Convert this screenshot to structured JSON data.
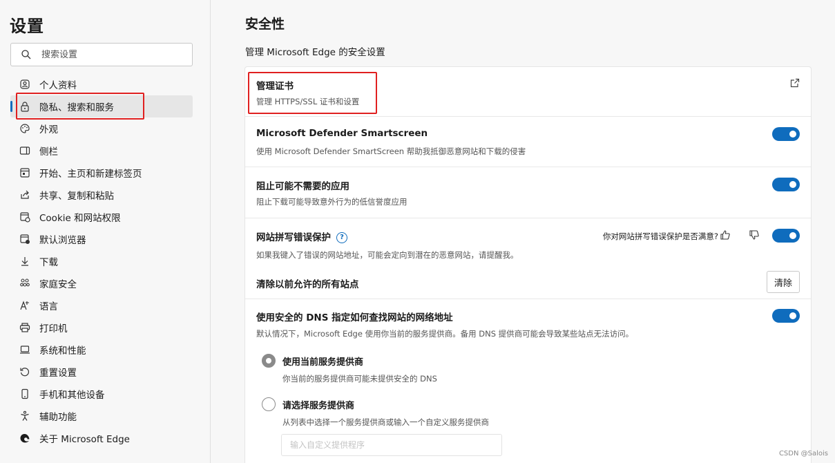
{
  "sidebar": {
    "title": "设置",
    "search_placeholder": "搜索设置",
    "items": [
      {
        "label": "个人资料",
        "icon": "profile-icon"
      },
      {
        "label": "隐私、搜索和服务",
        "icon": "lock-icon",
        "active": true
      },
      {
        "label": "外观",
        "icon": "palette-icon"
      },
      {
        "label": "侧栏",
        "icon": "sidebar-icon"
      },
      {
        "label": "开始、主页和新建标签页",
        "icon": "home-icon"
      },
      {
        "label": "共享、复制和粘贴",
        "icon": "share-icon"
      },
      {
        "label": "Cookie 和网站权限",
        "icon": "cookie-icon"
      },
      {
        "label": "默认浏览器",
        "icon": "browser-icon"
      },
      {
        "label": "下载",
        "icon": "download-icon"
      },
      {
        "label": "家庭安全",
        "icon": "family-icon"
      },
      {
        "label": "语言",
        "icon": "language-icon"
      },
      {
        "label": "打印机",
        "icon": "printer-icon"
      },
      {
        "label": "系统和性能",
        "icon": "laptop-icon"
      },
      {
        "label": "重置设置",
        "icon": "reset-icon"
      },
      {
        "label": "手机和其他设备",
        "icon": "phone-icon"
      },
      {
        "label": "辅助功能",
        "icon": "accessibility-icon"
      },
      {
        "label": "关于 Microsoft Edge",
        "icon": "edge-logo-icon"
      }
    ]
  },
  "main": {
    "title": "安全性",
    "subtitle": "管理 Microsoft Edge 的安全设置",
    "cert": {
      "title": "管理证书",
      "desc": "管理 HTTPS/SSL 证书和设置"
    },
    "smartscreen": {
      "title": "Microsoft Defender Smartscreen",
      "desc": "使用 Microsoft Defender SmartScreen 帮助我抵御恶意网站和下载的侵害",
      "enabled": true
    },
    "pua": {
      "title": "阻止可能不需要的应用",
      "desc": "阻止下载可能导致意外行为的低信誉度应用",
      "enabled": true
    },
    "typo": {
      "title": "网站拼写错误保护",
      "help": "?",
      "feedback": "你对网站拼写错误保护是否满意?",
      "desc": "如果我键入了错误的网站地址，可能会定向到潜在的恶意网站，请提醒我。",
      "enabled": true,
      "clear_title": "清除以前允许的所有站点",
      "clear_button": "清除"
    },
    "dns": {
      "title": "使用安全的 DNS 指定如何查找网站的网络地址",
      "desc": "默认情况下，Microsoft Edge 使用你当前的服务提供商。备用 DNS 提供商可能会导致某些站点无法访问。",
      "enabled": true,
      "option1_title": "使用当前服务提供商",
      "option1_desc": "你当前的服务提供商可能未提供安全的 DNS",
      "option2_title": "请选择服务提供商",
      "option2_desc": "从列表中选择一个服务提供商或输入一个自定义服务提供商",
      "custom_placeholder": "输入自定义提供程序",
      "selected": "current"
    }
  },
  "watermark": "CSDN @Salois",
  "colors": {
    "accent": "#0f6cbd",
    "highlight_box": "#e02020"
  }
}
